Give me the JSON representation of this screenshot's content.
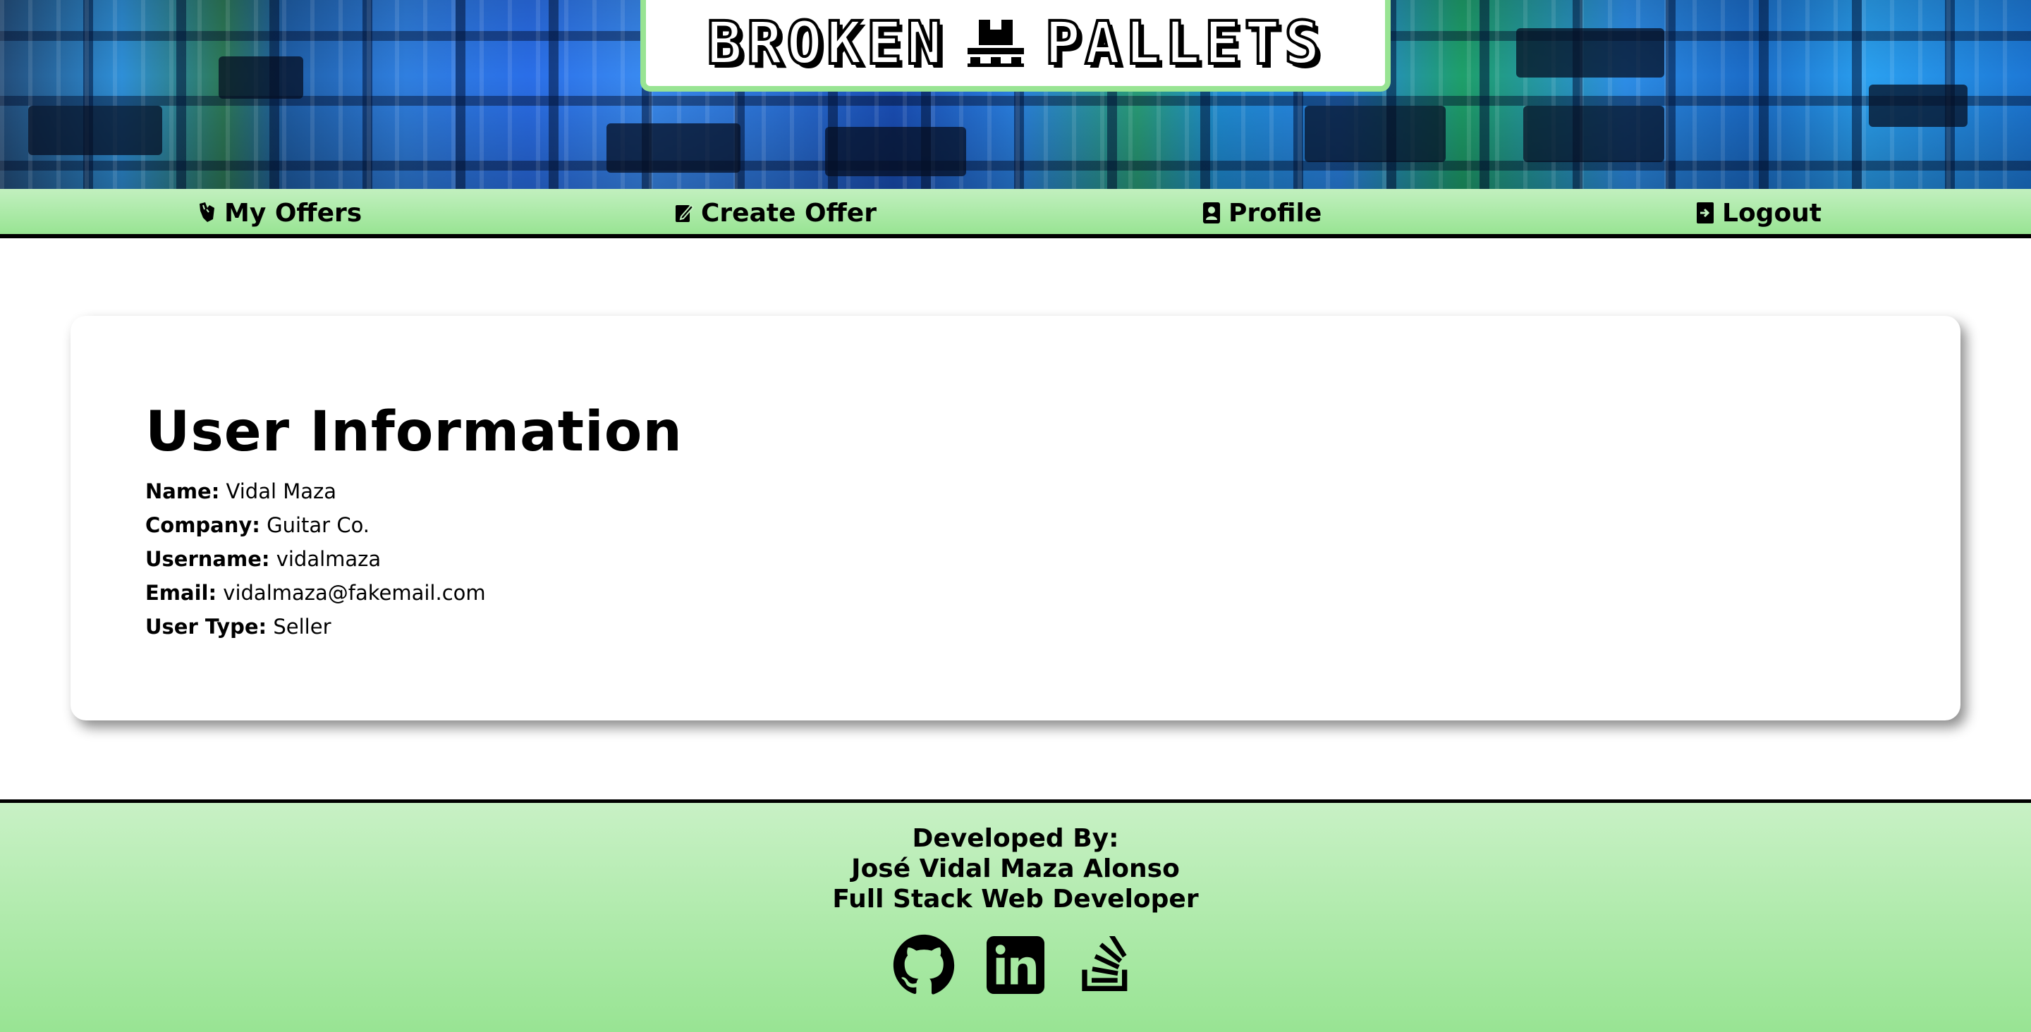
{
  "brand": {
    "title_left": "BROKEN",
    "title_right": "PALLETS",
    "logo_icon": "pallet-box-icon",
    "accent_color": "#98e493"
  },
  "nav": {
    "items": [
      {
        "label": "My Offers",
        "icon": "offers-icon"
      },
      {
        "label": "Create Offer",
        "icon": "create-offer-icon"
      },
      {
        "label": "Profile",
        "icon": "profile-icon"
      },
      {
        "label": "Logout",
        "icon": "logout-icon"
      }
    ]
  },
  "profile": {
    "heading": "User Information",
    "fields": [
      {
        "label": "Name:",
        "value": "Vidal Maza"
      },
      {
        "label": "Company:",
        "value": "Guitar Co."
      },
      {
        "label": "Username:",
        "value": "vidalmaza"
      },
      {
        "label": "Email:",
        "value": "vidalmaza@fakemail.com"
      },
      {
        "label": "User Type:",
        "value": "Seller"
      }
    ]
  },
  "footer": {
    "developed_by": "Developed By:",
    "author": "José Vidal Maza Alonso",
    "role": "Full Stack Web Developer",
    "links": [
      {
        "icon": "github-icon"
      },
      {
        "icon": "linkedin-icon"
      },
      {
        "icon": "stackoverflow-icon"
      }
    ]
  }
}
